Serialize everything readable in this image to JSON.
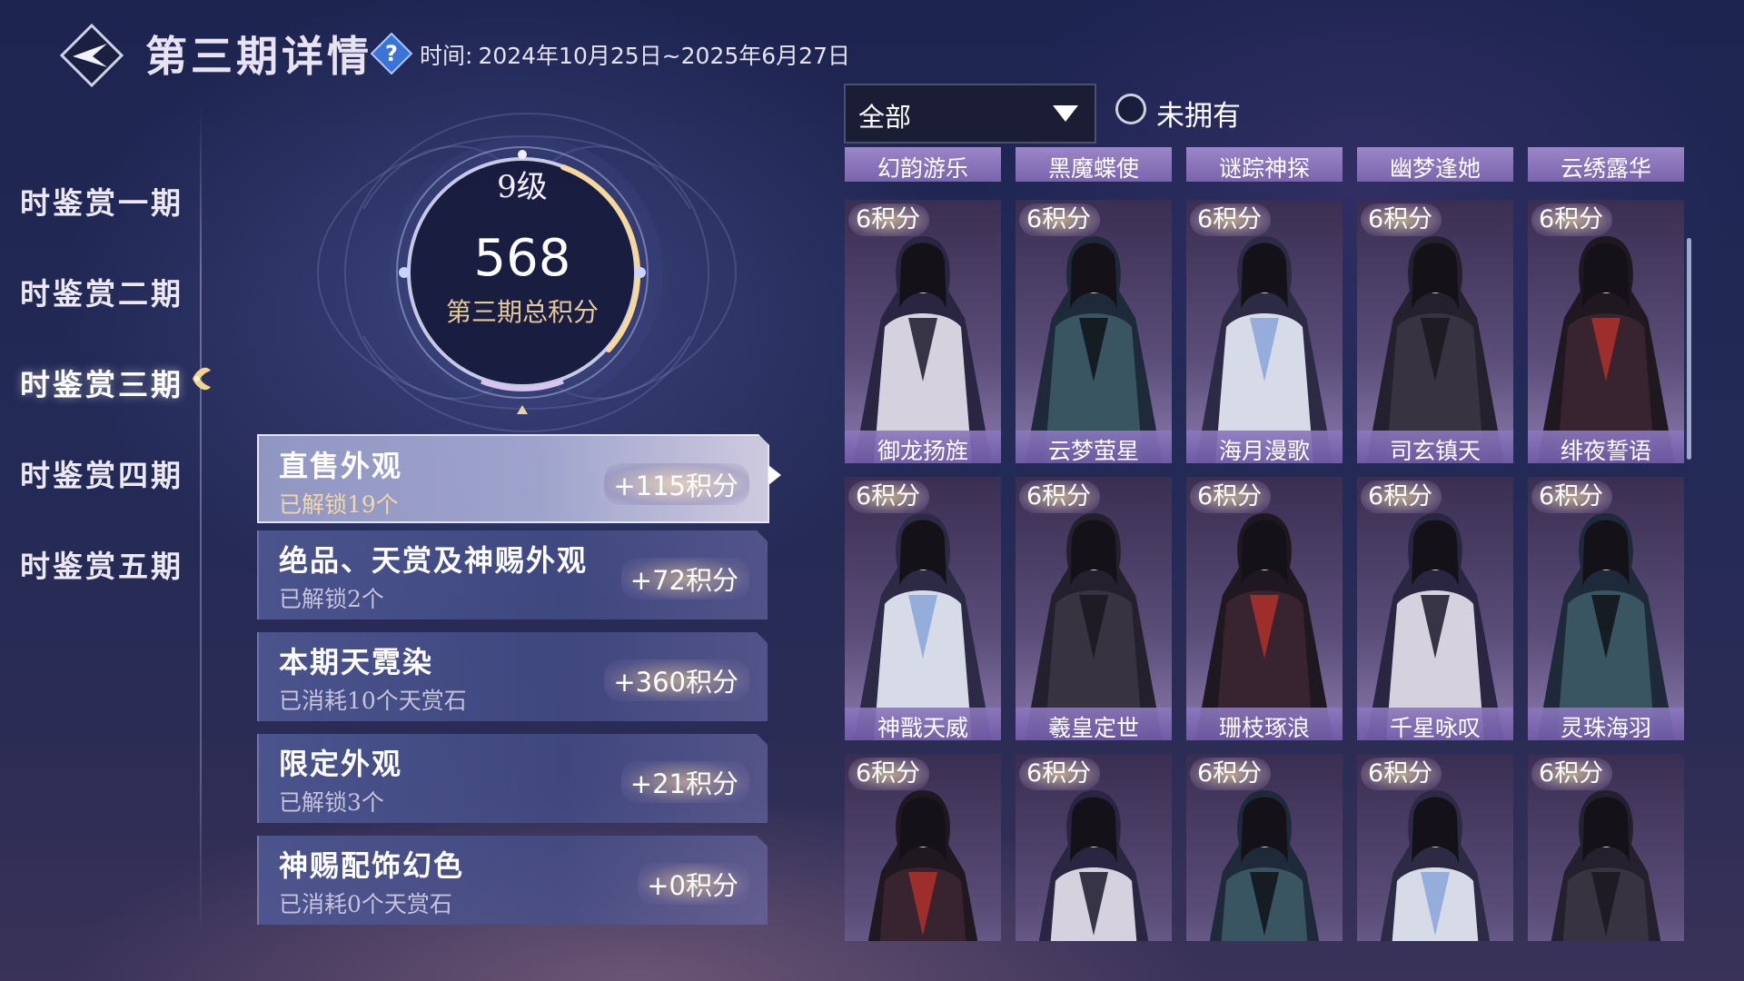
{
  "header": {
    "title": "第三期详情",
    "time_label": "时间:",
    "time_range": "2024年10月25日~2025年6月27日"
  },
  "nav": {
    "items": [
      {
        "label": "时鉴赏一期"
      },
      {
        "label": "时鉴赏二期"
      },
      {
        "label": "时鉴赏三期",
        "active": true
      },
      {
        "label": "时鉴赏四期"
      },
      {
        "label": "时鉴赏五期"
      }
    ]
  },
  "score": {
    "level": "9级",
    "total": "568",
    "label": "第三期总积分"
  },
  "categories": [
    {
      "title": "直售外观",
      "sub": "已解锁19个",
      "points": "+115积分",
      "active": true
    },
    {
      "title": "绝品、天赏及神赐外观",
      "sub": "已解锁2个",
      "points": "+72积分"
    },
    {
      "title": "本期天霓染",
      "sub": "已消耗10个天赏石",
      "points": "+360积分"
    },
    {
      "title": "限定外观",
      "sub": "已解锁3个",
      "points": "+21积分"
    },
    {
      "title": "神赐配饰幻色",
      "sub": "已消耗0个天赏石",
      "points": "+0积分"
    }
  ],
  "filter": {
    "selected": "全部",
    "not_owned_label": "未拥有"
  },
  "grid": {
    "top_row": [
      "幻韵游乐",
      "黑魔蝶使",
      "谜踪神探",
      "幽梦逢她",
      "云绣露华"
    ],
    "rows": [
      [
        {
          "badge": "6积分",
          "name": "御龙扬旌"
        },
        {
          "badge": "6积分",
          "name": "云梦萤星"
        },
        {
          "badge": "6积分",
          "name": "海月漫歌"
        },
        {
          "badge": "6积分",
          "name": "司玄镇天"
        },
        {
          "badge": "6积分",
          "name": "绯夜誓语"
        }
      ],
      [
        {
          "badge": "6积分",
          "name": "神戬天威"
        },
        {
          "badge": "6积分",
          "name": "羲皇定世"
        },
        {
          "badge": "6积分",
          "name": "珊枝琢浪"
        },
        {
          "badge": "6积分",
          "name": "千星咏叹"
        },
        {
          "badge": "6积分",
          "name": "灵珠海羽"
        }
      ],
      [
        {
          "badge": "6积分"
        },
        {
          "badge": "6积分"
        },
        {
          "badge": "6积分"
        },
        {
          "badge": "6积分"
        },
        {
          "badge": "6积分"
        }
      ]
    ]
  },
  "icons": {
    "back": "back-arrow-icon",
    "help": "question-diamond-icon",
    "nav_active": "leaf-ornament-icon",
    "caret": "triangle-down-icon"
  },
  "colors": {
    "gold": "#e7c999",
    "card_name_bar": "#8a74bd",
    "background": "#232a56"
  }
}
